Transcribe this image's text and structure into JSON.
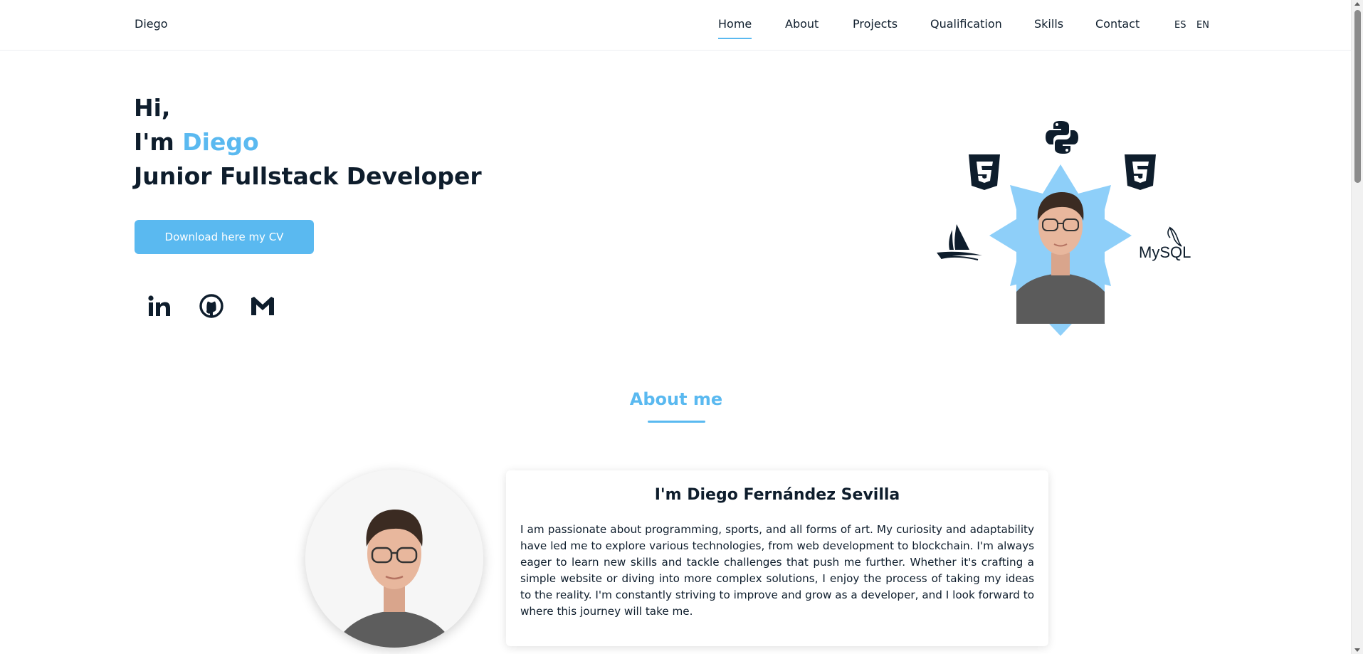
{
  "header": {
    "brand": "Diego",
    "nav": [
      {
        "label": "Home",
        "active": true
      },
      {
        "label": "About",
        "active": false
      },
      {
        "label": "Projects",
        "active": false
      },
      {
        "label": "Qualification",
        "active": false
      },
      {
        "label": "Skills",
        "active": false
      },
      {
        "label": "Contact",
        "active": false
      }
    ],
    "languages": [
      "ES",
      "EN"
    ]
  },
  "hero": {
    "greeting": "Hi,",
    "im": "I'm",
    "name": "Diego",
    "title": "Junior Fullstack Developer",
    "cv_button": "Download here my CV",
    "socials": [
      "linkedin-icon",
      "github-icon",
      "gmail-icon"
    ],
    "tech_icons": [
      "python-icon",
      "html5-icon",
      "css3-icon",
      "mariadb-icon",
      "mysql-icon"
    ],
    "mysql_label": "MySQL"
  },
  "about": {
    "section_title": "About me",
    "card_title": "I'm Diego Fernández Sevilla",
    "card_text": "I am passionate about programming, sports, and all forms of art. My curiosity and adaptability have led me to explore various technologies, from web development to blockchain. I'm always eager to learn new skills and tackle challenges that push me further. Whether it's crafting a simple website or diving into more complex solutions, I enjoy the process of taking my ideas to the reality. I'm constantly striving to improve and grow as a developer, and I look forward to where this journey will take me."
  },
  "colors": {
    "accent": "#5ab9f0",
    "text": "#0e1d2c",
    "star_bg": "#8ecff9"
  }
}
